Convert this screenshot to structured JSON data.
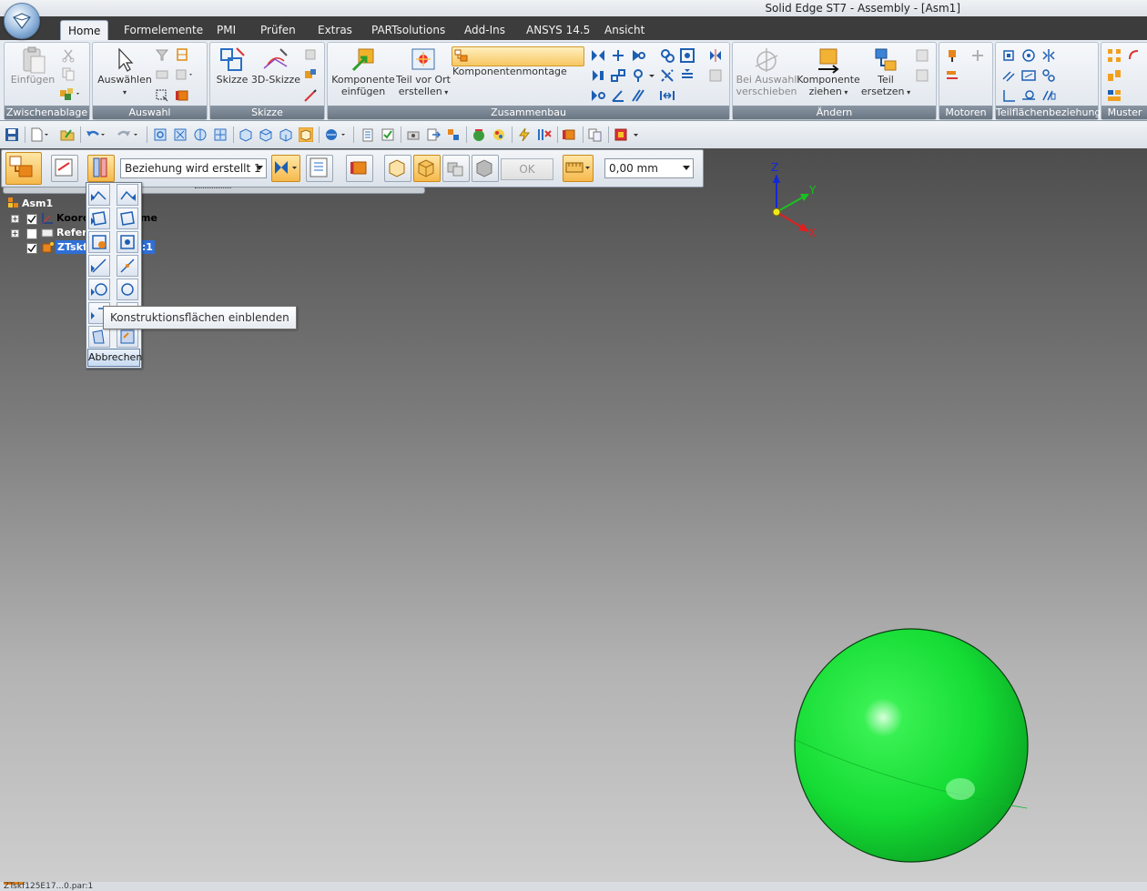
{
  "window": {
    "title": "Solid Edge ST7 - Assembly - [Asm1]"
  },
  "tabs": [
    "Home",
    "Formelemente",
    "PMI",
    "Prüfen",
    "Extras",
    "PARTsolutions",
    "Add-Ins",
    "ANSYS 14.5",
    "Ansicht"
  ],
  "ribbon": {
    "groups": [
      "Zwischenablage",
      "Auswahl",
      "Skizze",
      "Zusammenbau",
      "Ändern",
      "Motoren",
      "Teilflächenbeziehung",
      "Muster"
    ],
    "paste": "Einfügen",
    "select": "Auswählen",
    "sketch": "Skizze",
    "sketch3d": "3D-Skizze",
    "insert_line1": "Komponente",
    "insert_line2": "einfügen",
    "create_line1": "Teil vor Ort",
    "create_line2": "erstellen",
    "assemble": "Komponentenmontage",
    "move_line1": "Bei Auswahl",
    "move_line2": "verschieben",
    "drag_line1": "Komponente",
    "drag_line2": "ziehen",
    "replace_line1": "Teil",
    "replace_line2": "ersetzen"
  },
  "command_bar": {
    "relationship_select": "Beziehung wird erstellt 1",
    "ok": "OK",
    "offset_value": "0,00 mm"
  },
  "tree": {
    "root": "Asm1",
    "item1": "Koord",
    "item1_tail": "me",
    "item2": "Refere",
    "item3": "ZTskf",
    "item3_tail": "ar:1"
  },
  "flyout": {
    "cancel": "Abbrechen",
    "tooltip": "Konstruktionsflächen einblenden"
  },
  "triad": {
    "z": "Z",
    "y": "Y",
    "x": "X"
  },
  "statusbar": {
    "text": "ZTskf125E17...0.par:1"
  },
  "colors": {
    "sphere": "#19e03a",
    "accent": "#f5b84b",
    "tab_bar": "#3c3c3c"
  }
}
